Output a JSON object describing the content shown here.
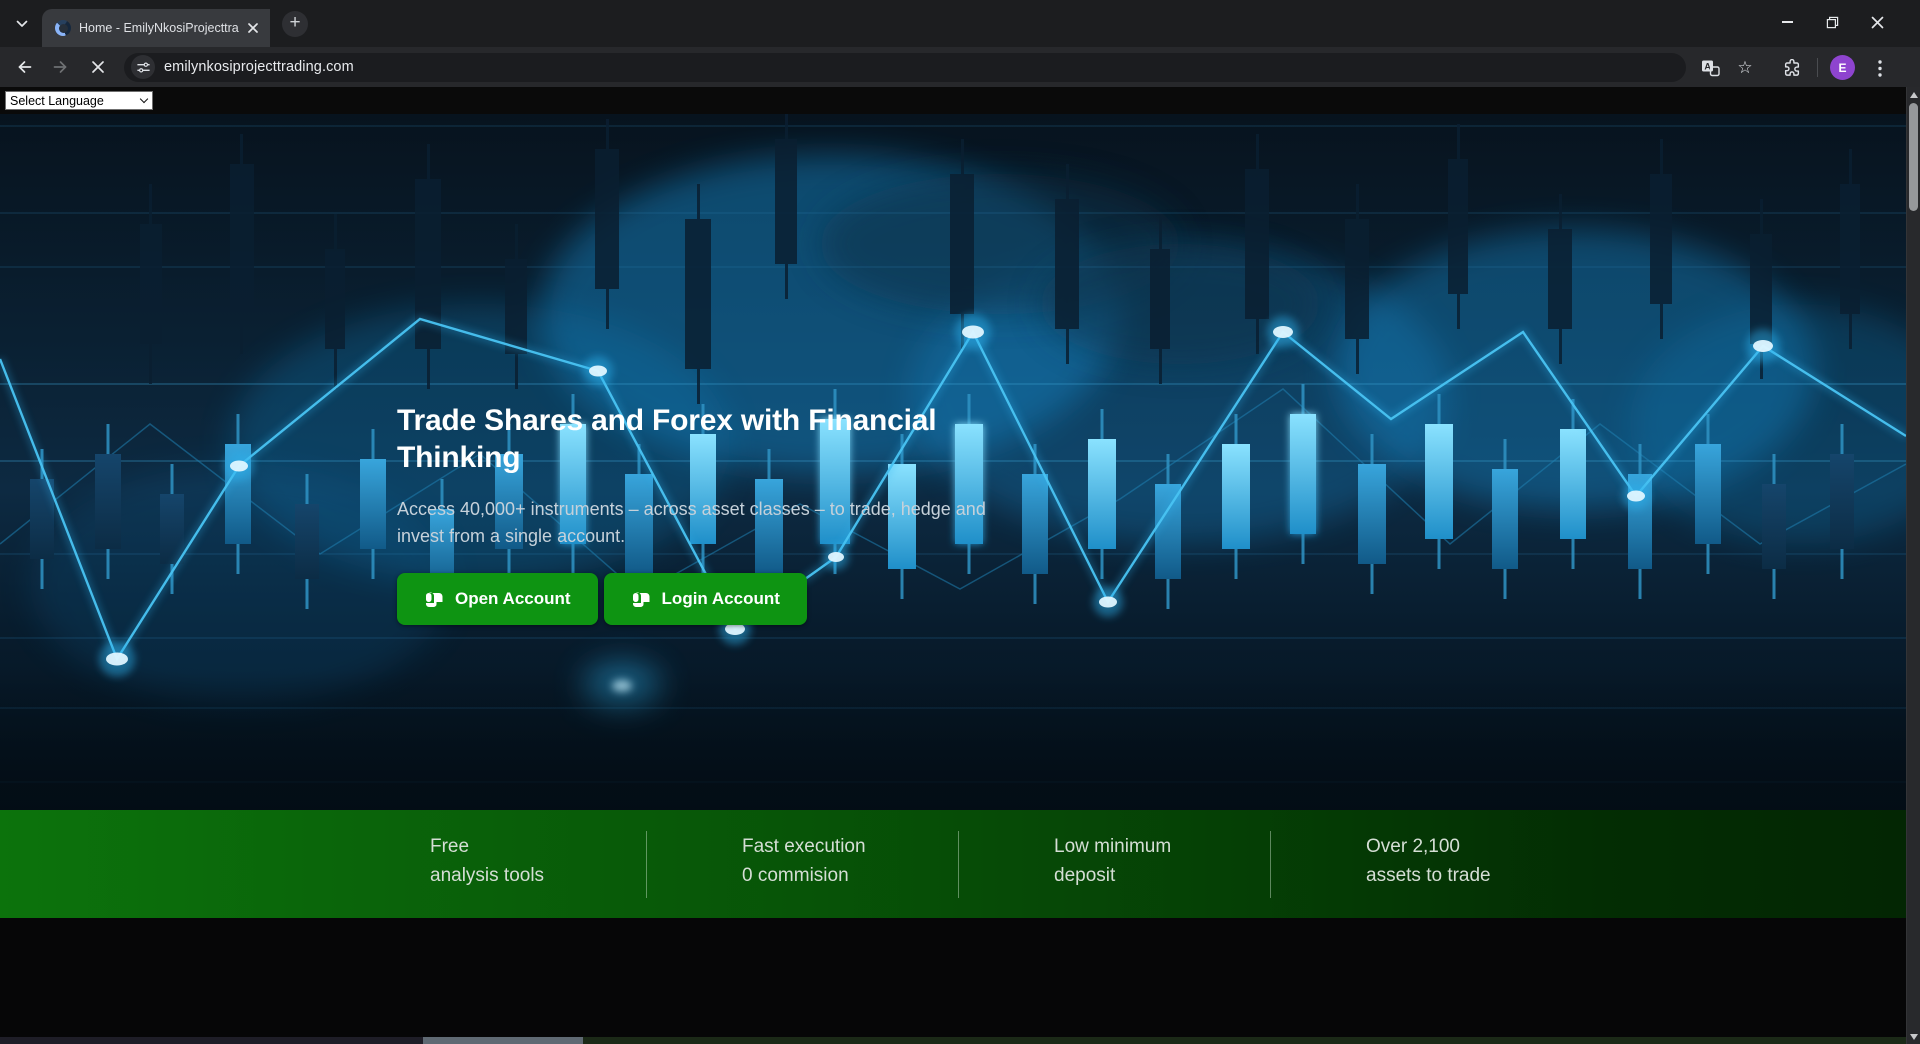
{
  "browser": {
    "tab_title": "Home - EmilyNkosiProjecttra",
    "url": "emilynkosiprojecttrading.com",
    "avatar_initial": "E"
  },
  "page": {
    "language_selector_value": "Select Language",
    "hero": {
      "heading_line1": "Trade Shares and Forex with Financial",
      "heading_line2": "Thinking",
      "subheading_line1": "Access 40,000+ instruments – across asset classes – to trade, hedge and",
      "subheading_line2": "invest from a single account.",
      "open_account_label": "Open Account",
      "login_account_label": "Login Account"
    },
    "features": [
      {
        "line1": "Free",
        "line2": "analysis tools"
      },
      {
        "line1": "Fast execution",
        "line2": "0 commision"
      },
      {
        "line1": "Low minimum",
        "line2": "deposit"
      },
      {
        "line1": "Over 2,100",
        "line2": "assets to trade"
      }
    ],
    "colors": {
      "button_green": "#0e9412",
      "banner_green_left": "#0c730c",
      "banner_green_right": "#032603",
      "hero_background_blue": "#0a2134",
      "hero_glow_cyan": "#2db3ef"
    }
  }
}
